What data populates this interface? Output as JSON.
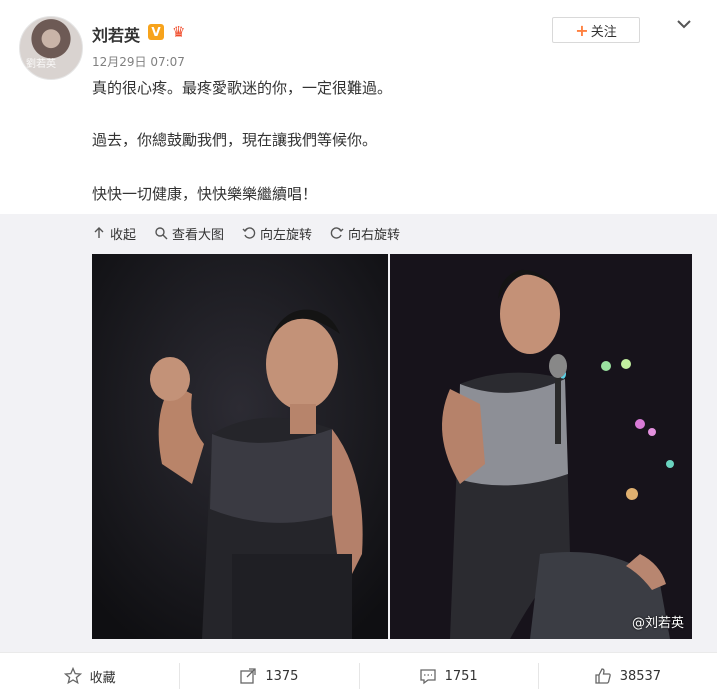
{
  "post": {
    "author": "刘若英",
    "verified_badge": "V",
    "avatar_signature": "劉若英",
    "time": "12月29日 07:07",
    "follow_label": "关注",
    "paragraphs": [
      "真的很心疼。最疼愛歌迷的你，一定很難過。",
      "過去，你總鼓勵我們，現在讓我們等候你。",
      "快快一切健康，快快樂樂繼續唱！"
    ]
  },
  "media_toolbar": {
    "collapse": "收起",
    "view_large": "查看大图",
    "rotate_left": "向左旋转",
    "rotate_right": "向右旋转"
  },
  "photos": {
    "watermark": "@刘若英"
  },
  "actions": {
    "favorite": "收藏",
    "repost": "1375",
    "comment": "1751",
    "like": "38537"
  },
  "colors": {
    "accent": "#ff8140",
    "badge": "#f7a31b",
    "text": "#333333",
    "muted": "#808080"
  }
}
